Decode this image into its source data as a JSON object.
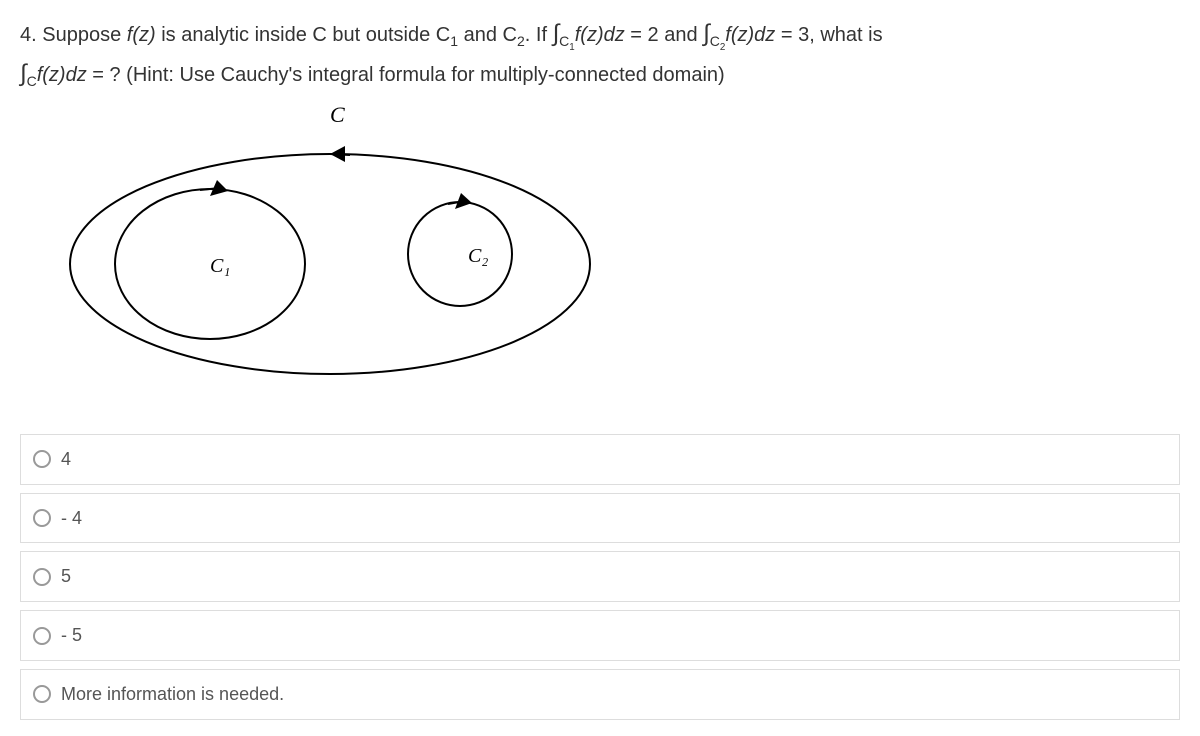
{
  "question": {
    "number": "4.",
    "text_part1": "Suppose ",
    "fz": "f(z)",
    "text_part2": " is analytic inside C but outside C",
    "sub1": "1",
    "text_part3": " and C",
    "sub2": "2",
    "text_part4": ". If ",
    "int_c1": "∫",
    "c1_sub": "C",
    "c1_subnum": "1",
    "fzdz": "f(z)dz",
    "eq2": " = 2 and ",
    "int_c2": "∫",
    "c2_sub": "C",
    "c2_subnum": "2",
    "eq3": " = 3, what is",
    "line2_int": "∫",
    "line2_c": "C",
    "line2_q": " = ? (Hint: Use Cauchy's integral formula for multiply-connected domain)"
  },
  "diagram": {
    "label_c": "C",
    "label_c1": "C₁",
    "label_c2": "C₂"
  },
  "options": [
    {
      "label": "4"
    },
    {
      "label": "- 4"
    },
    {
      "label": "5"
    },
    {
      "label": "- 5"
    },
    {
      "label": "More information is needed."
    }
  ]
}
